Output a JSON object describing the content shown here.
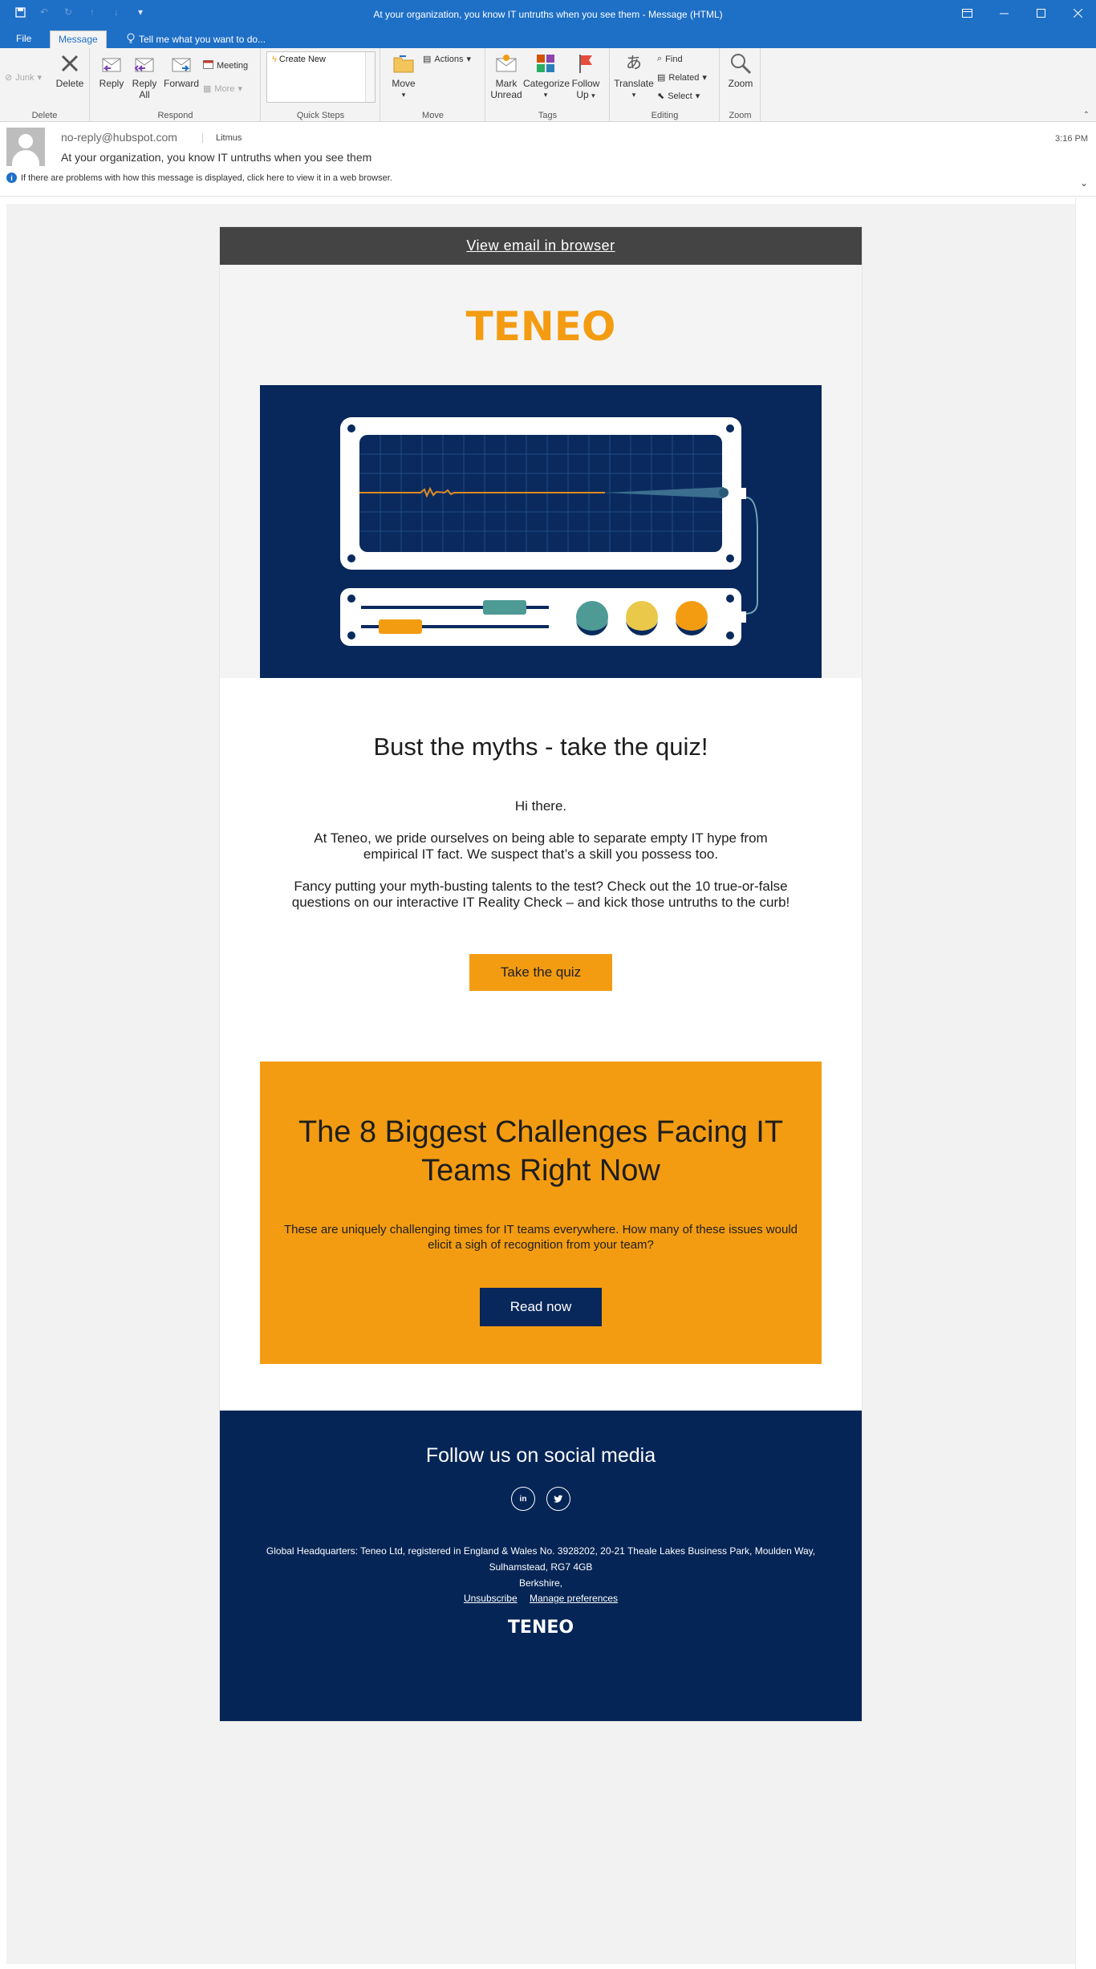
{
  "window": {
    "title": "At your organization, you know IT untruths when you see them - Message (HTML)"
  },
  "tabs": {
    "file": "File",
    "message": "Message",
    "tell_me": "Tell me what you want to do..."
  },
  "ribbon": {
    "delete_group": {
      "junk": "Junk",
      "delete": "Delete",
      "label": "Delete"
    },
    "respond_group": {
      "reply": "Reply",
      "reply_all_1": "Reply",
      "reply_all_2": "All",
      "forward": "Forward",
      "meeting": "Meeting",
      "more": "More",
      "label": "Respond"
    },
    "quick_steps": {
      "create_new": "Create New",
      "label": "Quick Steps"
    },
    "move_group": {
      "move": "Move",
      "actions": "Actions",
      "label": "Move"
    },
    "tags_group": {
      "mark_unread_1": "Mark",
      "mark_unread_2": "Unread",
      "categorize": "Categorize",
      "follow_up_1": "Follow",
      "follow_up_2": "Up",
      "label": "Tags"
    },
    "editing_group": {
      "translate": "Translate",
      "find": "Find",
      "related": "Related",
      "select": "Select",
      "label": "Editing"
    },
    "zoom_group": {
      "zoom": "Zoom",
      "label": "Zoom"
    }
  },
  "message": {
    "from": "no-reply@hubspot.com",
    "to": "Litmus",
    "subject": "At your organization, you know IT untruths when you see them",
    "time": "3:16 PM",
    "infobar": "If there are problems with how this message is displayed, click here to view it in a web browser."
  },
  "email": {
    "view_in_browser": "View email in browser",
    "logo_text": "TENEO",
    "heading": "Bust the myths - take the quiz!",
    "greeting": "Hi there.",
    "para1": "At Teneo, we pride ourselves on being able to separate empty IT hype from empirical IT fact. We suspect that’s a skill you possess too.",
    "para2": "Fancy putting your myth-busting talents to the test? Check out the 10 true-or-false questions on our interactive IT Reality Check – and kick those untruths to the curb!",
    "cta_quiz": "Take the quiz",
    "promo_heading": "The 8 Biggest Challenges Facing IT Teams Right Now",
    "promo_text": "These are uniquely challenging times for IT teams everywhere. How many of these issues would elicit a sigh of recognition from your team?",
    "cta_read": "Read now",
    "footer_heading": "Follow us on social media",
    "social_linkedin": "in",
    "address_1": "Global Headquarters: Teneo Ltd, registered in England & Wales No. 3928202, 20-21 Theale Lakes Business Park, Moulden Way, Sulhamstead, RG7 4GB",
    "address_2": "Berkshire,",
    "unsubscribe": "Unsubscribe",
    "manage_prefs": "Manage preferences",
    "footer_logo": "TENEO"
  },
  "colors": {
    "brand_orange": "#f39c12",
    "navy": "#052556",
    "title_blue": "#1e6fc6"
  }
}
